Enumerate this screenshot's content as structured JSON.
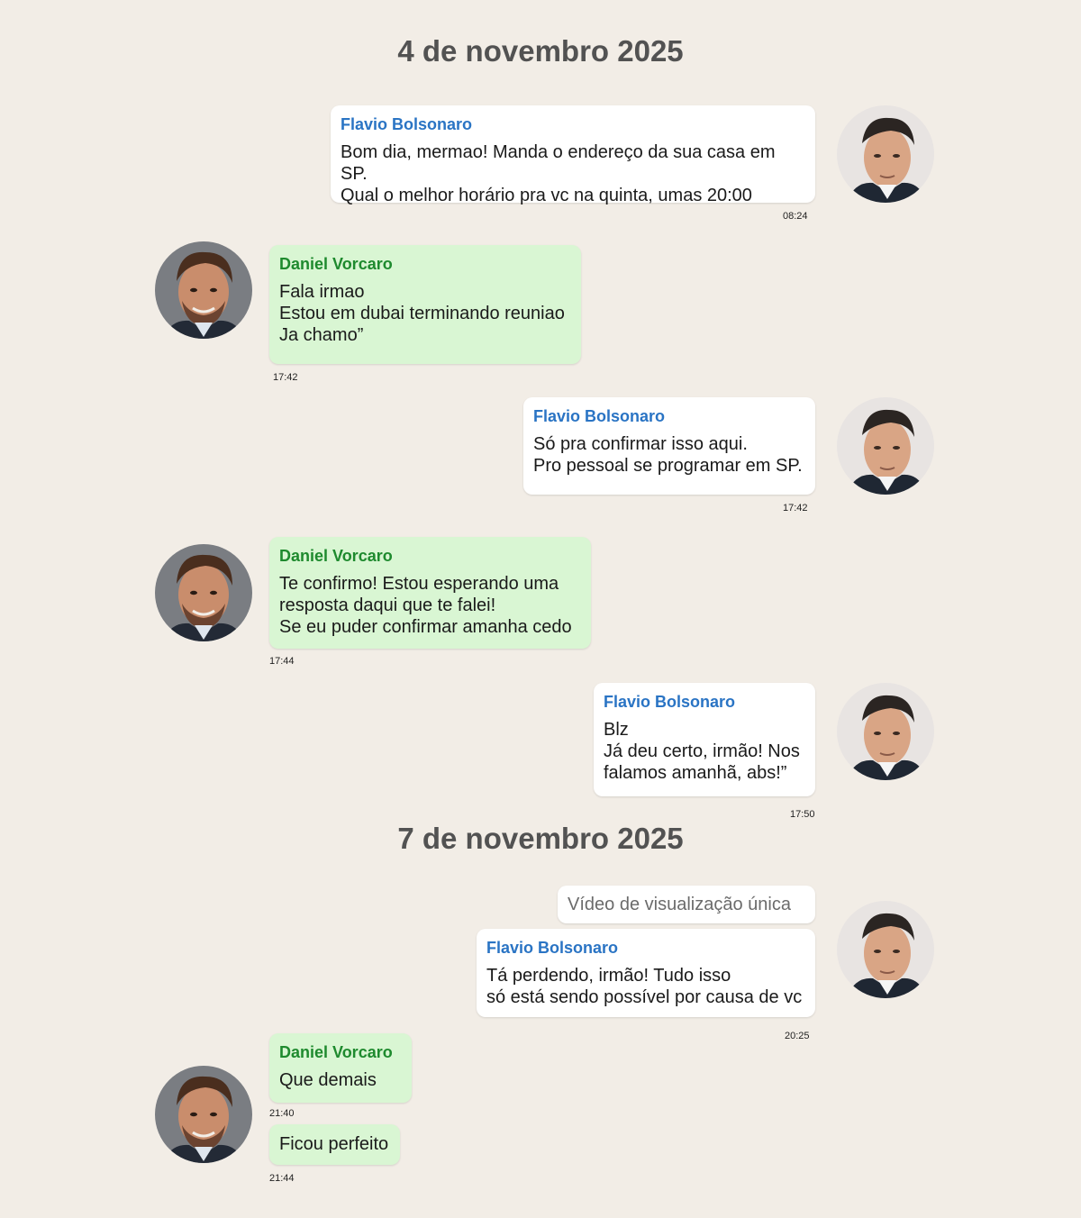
{
  "dates": [
    "4 de novembro 2025",
    "7 de novembro 2025"
  ],
  "contacts": {
    "flavio": {
      "name": "Flavio Bolsonaro",
      "name_color": "#2a74c4",
      "bubble_color": "#ffffff",
      "avatar": "flavio-avatar"
    },
    "daniel": {
      "name": "Daniel Vorcaro",
      "name_color": "#1e8a2e",
      "bubble_color": "#d9f6d3",
      "avatar": "daniel-avatar"
    }
  },
  "messages": [
    {
      "sender": "Flavio Bolsonaro",
      "text": "Bom dia, mermao! Manda o endereço da sua casa em SP.\nQual o melhor horário pra vc na quinta, umas 20:00",
      "time": "08:24"
    },
    {
      "sender": "Daniel Vorcaro",
      "text": "Fala irmao\nEstou em dubai terminando reuniao\nJa chamo”",
      "time": "17:42"
    },
    {
      "sender": "Flavio Bolsonaro",
      "text": "Só pra confirmar isso aqui.\n Pro pessoal se programar em SP.",
      "time": "17:42"
    },
    {
      "sender": "Daniel Vorcaro",
      "text": "Te confirmo! Estou esperando uma\nresposta daqui que te falei!\nSe eu puder confirmar amanha cedo",
      "time": "17:44"
    },
    {
      "sender": "Flavio Bolsonaro",
      "text": "Blz\nJá deu certo, irmão! Nos\n falamos amanhã, abs!”",
      "time": "17:50"
    },
    {
      "notice": "Vídeo de visualização única"
    },
    {
      "sender": "Flavio Bolsonaro",
      "text": "Tá perdendo, irmão! Tudo isso\n só está sendo possível por causa de vc",
      "time": "20:25"
    },
    {
      "sender": "Daniel Vorcaro",
      "text": "Que demais",
      "time": "21:40"
    },
    {
      "text": "Ficou perfeito",
      "time": "21:44"
    }
  ]
}
